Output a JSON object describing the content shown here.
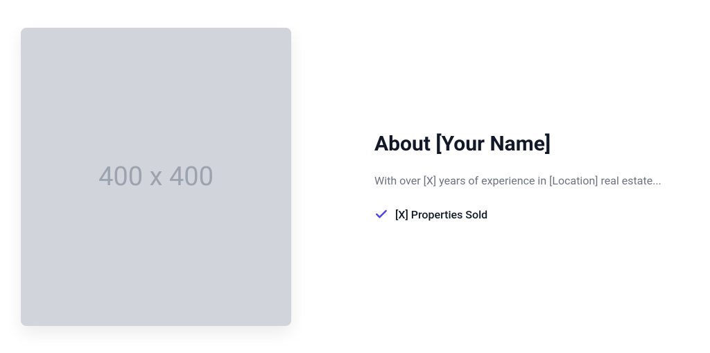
{
  "image": {
    "placeholder_text": "400 x 400"
  },
  "about": {
    "heading": "About [Your Name]",
    "description": "With over [X] years of experience in [Location] real estate...",
    "achievement": "[X] Properties Sold"
  },
  "colors": {
    "check": "#4f46e5"
  }
}
